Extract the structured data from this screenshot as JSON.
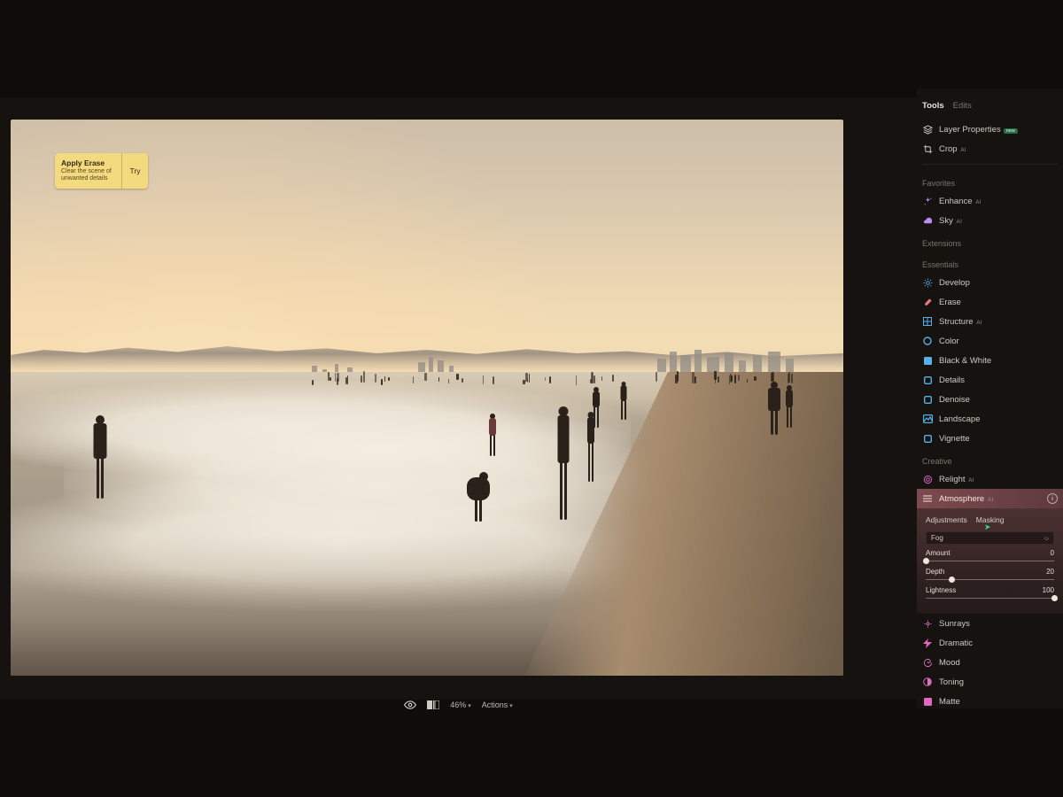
{
  "tip": {
    "title": "Apply Erase",
    "subtitle": "Clear the scene of unwanted details",
    "try": "Try"
  },
  "bottombar": {
    "zoom": "46%",
    "actions": "Actions"
  },
  "tabs": {
    "tools": "Tools",
    "edits": "Edits",
    "active": "tools"
  },
  "top_tools": [
    {
      "id": "layer-properties",
      "label": "Layer Properties",
      "icon": "layers",
      "badge": "new"
    },
    {
      "id": "crop",
      "label": "Crop",
      "icon": "crop",
      "ai": true
    }
  ],
  "sections": {
    "favorites": {
      "title": "Favorites",
      "items": [
        {
          "id": "enhance",
          "label": "Enhance",
          "icon": "sparkle",
          "color": "#b78cf2",
          "ai": true
        },
        {
          "id": "sky",
          "label": "Sky",
          "icon": "cloud",
          "color": "#b78cf2",
          "ai": true
        }
      ]
    },
    "extensions": {
      "title": "Extensions",
      "items": []
    },
    "essentials": {
      "title": "Essentials",
      "items": [
        {
          "id": "develop",
          "label": "Develop",
          "icon": "sun",
          "color": "#58b0e8"
        },
        {
          "id": "erase",
          "label": "Erase",
          "icon": "eraser",
          "color": "#e87a7a"
        },
        {
          "id": "structure",
          "label": "Structure",
          "icon": "grid",
          "color": "#58b0e8",
          "ai": true
        },
        {
          "id": "color",
          "label": "Color",
          "icon": "circle",
          "color": "#58b0e8"
        },
        {
          "id": "bw",
          "label": "Black & White",
          "icon": "square",
          "color": "#58b0e8"
        },
        {
          "id": "details",
          "label": "Details",
          "icon": "square-o",
          "color": "#58b0e8"
        },
        {
          "id": "denoise",
          "label": "Denoise",
          "icon": "square-o",
          "color": "#58b0e8"
        },
        {
          "id": "landscape",
          "label": "Landscape",
          "icon": "image",
          "color": "#58b0e8"
        },
        {
          "id": "vignette",
          "label": "Vignette",
          "icon": "square-o",
          "color": "#58b0e8"
        }
      ]
    },
    "creative": {
      "title": "Creative",
      "items_before": [
        {
          "id": "relight",
          "label": "Relight",
          "icon": "target",
          "color": "#e069c2",
          "ai": true
        }
      ],
      "atmosphere": {
        "label": "Atmosphere",
        "ai": true,
        "subtabs": {
          "adjustments": "Adjustments",
          "masking": "Masking"
        },
        "dropdown": "Fog",
        "sliders": [
          {
            "name": "Amount",
            "value": 0,
            "min": 0,
            "max": 100
          },
          {
            "name": "Depth",
            "value": 20,
            "min": 0,
            "max": 100
          },
          {
            "name": "Lightness",
            "value": 100,
            "min": 0,
            "max": 100
          }
        ]
      },
      "items_after": [
        {
          "id": "sunrays",
          "label": "Sunrays",
          "icon": "sun-o",
          "color": "#e069c2"
        },
        {
          "id": "dramatic",
          "label": "Dramatic",
          "icon": "bolt",
          "color": "#e069c2"
        },
        {
          "id": "mood",
          "label": "Mood",
          "icon": "swirl",
          "color": "#e069c2"
        },
        {
          "id": "toning",
          "label": "Toning",
          "icon": "half",
          "color": "#e069c2"
        },
        {
          "id": "matte",
          "label": "Matte",
          "icon": "square",
          "color": "#e069c2"
        }
      ]
    }
  }
}
